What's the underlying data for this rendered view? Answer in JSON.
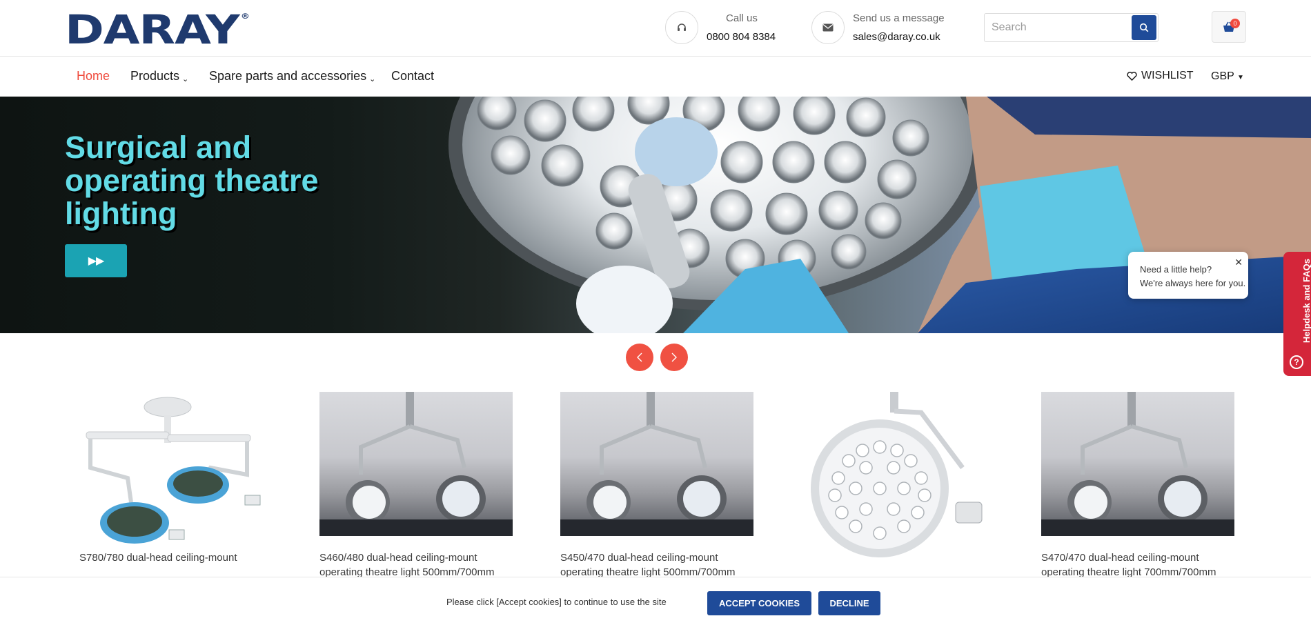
{
  "header": {
    "logo_text": "DARAY",
    "logo_mark": "®",
    "call_label": "Call us",
    "call_value": "0800 804 8384",
    "message_label": "Send us a message",
    "message_value": "sales@daray.co.uk",
    "search_placeholder": "Search",
    "cart_count": "0"
  },
  "nav": {
    "home": "Home",
    "products": "Products",
    "spare_parts": "Spare parts and accessories",
    "contact": "Contact",
    "wishlist": "WISHLIST",
    "currency": "GBP"
  },
  "hero": {
    "title": "Surgical and operating theatre lighting",
    "button": "▶▶"
  },
  "help": {
    "line1": "Need a little help?",
    "line2": "We're always here for you.",
    "tab": "Helpdesk and FAQs"
  },
  "products": [
    {
      "name": "S780/780 dual-head ceiling-mount"
    },
    {
      "name": "S460/480 dual-head ceiling-mount operating theatre light 500mm/700mm"
    },
    {
      "name": "S450/470 dual-head ceiling-mount operating theatre light 500mm/700mm"
    },
    {
      "name": ""
    },
    {
      "name": "S470/470 dual-head ceiling-mount operating theatre light 700mm/700mm"
    }
  ],
  "cookie": {
    "message": "Please click [Accept cookies] to continue to use the site",
    "accept": "ACCEPT COOKIES",
    "decline": "DECLINE"
  },
  "colors": {
    "brand_navy": "#1f3a6e",
    "button_blue": "#1f4b99",
    "accent_red": "#ef4a3c",
    "hero_title": "#62dbe6",
    "hero_button": "#1ba3b3",
    "help_tab": "#d4263a"
  }
}
